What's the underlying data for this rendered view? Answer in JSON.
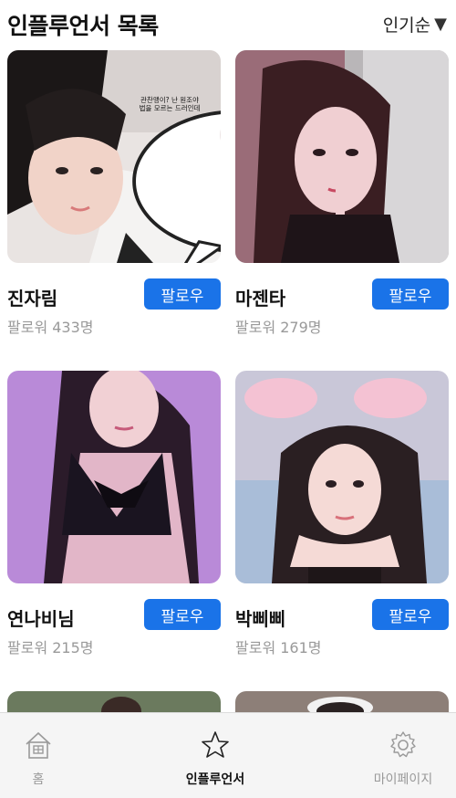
{
  "header": {
    "title": "인플루언서 목록",
    "sort_label": "인기순",
    "sort_caret": "▼"
  },
  "influencers": [
    {
      "name": "진자림",
      "followers": "팔로워 433명",
      "follow_label": "팔로우",
      "bubble_text": "관찬맹이? 난 원조야 법을 모르는 드러인데"
    },
    {
      "name": "마젠타",
      "followers": "팔로워 279명",
      "follow_label": "팔로우"
    },
    {
      "name": "연나비님",
      "followers": "팔로워 215명",
      "follow_label": "팔로우"
    },
    {
      "name": "박삐삐",
      "followers": "팔로워 161명",
      "follow_label": "팔로우"
    }
  ],
  "nav": {
    "home": "홈",
    "influencers": "인플루언서",
    "mypage": "마이페이지"
  },
  "colors": {
    "accent": "#1a73e8",
    "nav_background": "#f5f5f5",
    "muted_text": "#999999"
  }
}
